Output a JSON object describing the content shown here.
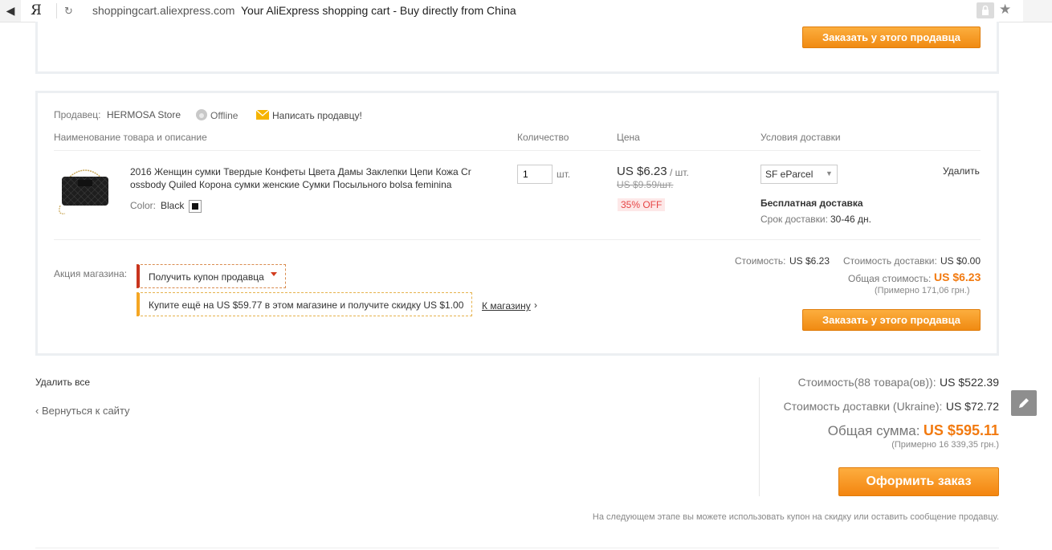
{
  "browser": {
    "back_glyph": "◀",
    "yandex_logo": "Я",
    "reload_glyph": "↻",
    "domain": "shoppingcart.aliexpress.com",
    "page_title": "Your AliExpress shopping cart - Buy directly from China",
    "star_glyph": "★"
  },
  "prev_store": {
    "order_button": "Заказать у этого продавца"
  },
  "store": {
    "seller_label": "Продавец:",
    "seller_name": "HERMOSA Store",
    "status": "Offline",
    "message_link": "Написать продавцу!",
    "headers": {
      "product": "Наименование товара и описание",
      "quantity": "Количество",
      "price": "Цена",
      "shipping": "Условия доставки"
    },
    "item": {
      "title": "2016 Женщин сумки Твердые Конфеты Цвета Дамы Заклепки Цепи Кожа Crossbody Quiled Корона сумки женские Сумки Посыльного bolsa feminina",
      "color_label": "Color:",
      "color_value": "Black",
      "quantity": "1",
      "unit": "шт.",
      "price": "US $6.23",
      "price_unit": "/ шт.",
      "old_price": "US $9.59/шт.",
      "discount": "35% OFF",
      "shipping_method": "SF eParcel",
      "free_shipping": "Бесплатная доставка",
      "delivery_label": "Срок доставки:",
      "delivery_time": "30-46 дн.",
      "delete_link": "Удалить"
    },
    "promo_label": "Акция магазина:",
    "coupon_button": "Получить купон продавца",
    "promo_text": "Купите ещё на US $59.77 в этом магазине и получите скидку US $1.00",
    "store_link": "К магазину",
    "cost_label": "Стоимость:",
    "cost_value": "US $6.23",
    "shipping_cost_label": "Стоимость доставки:",
    "shipping_cost_value": "US $0.00",
    "total_label": "Общая стоимость:",
    "total_value": "US $6.23",
    "approx": "(Примерно 171,06 грн.)",
    "order_button": "Заказать у этого продавца"
  },
  "footer": {
    "delete_all": "Удалить все",
    "back_link": "Вернуться к сайту",
    "items_cost_label": "Стоимость(88 товара(ов)):",
    "items_cost_value": "US $522.39",
    "shipping_label": "Стоимость доставки (Ukraine):",
    "shipping_value": "US $72.72",
    "grand_total_label": "Общая сумма:",
    "grand_total_value": "US $595.11",
    "grand_approx": "(Примерно 16 339,35 грн.)",
    "checkout_button": "Оформить заказ",
    "note": "На следующем этапе вы можете использовать купон на скидку или оставить сообщение продавцу."
  },
  "colors": {
    "accent_orange": "#f08a12",
    "price_orange": "#f27a10",
    "discount_red": "#e64545"
  }
}
